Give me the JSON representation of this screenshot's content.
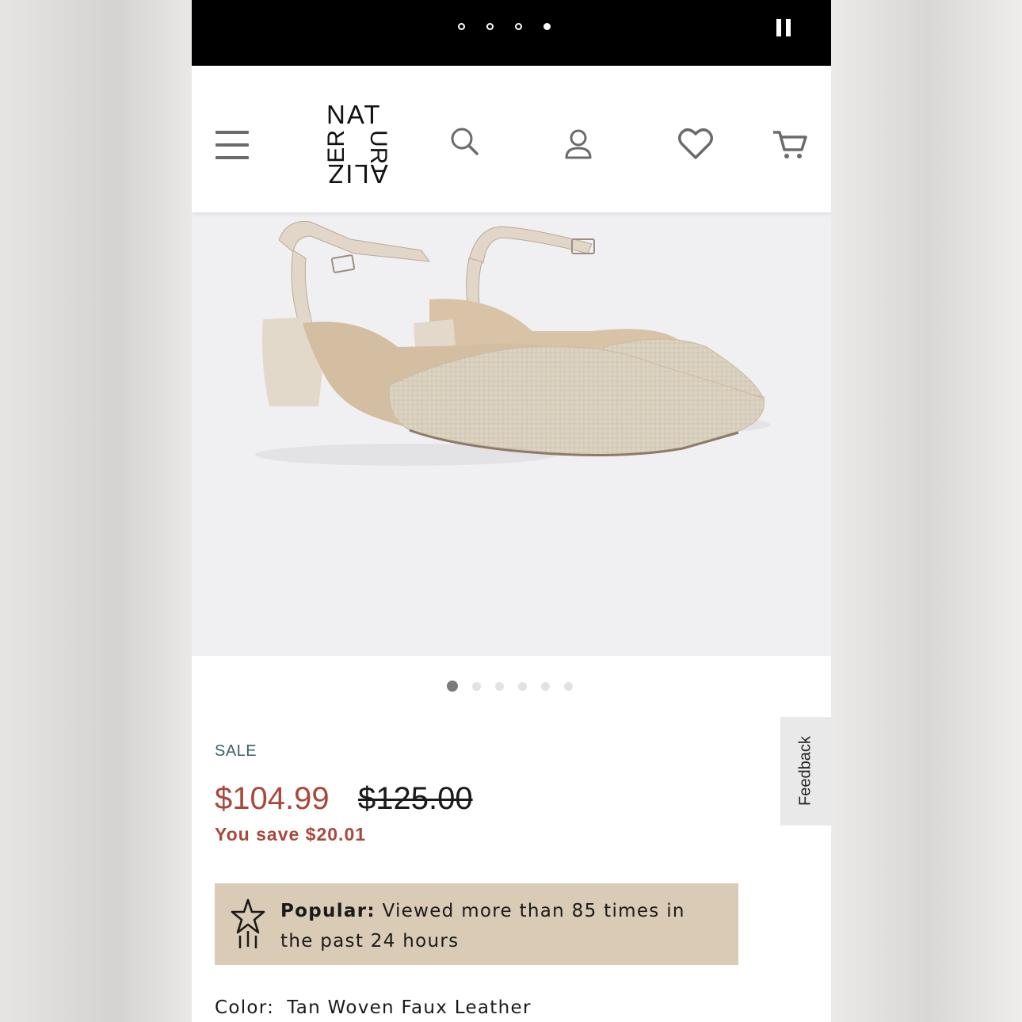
{
  "story": {
    "dots": [
      false,
      false,
      false,
      true
    ],
    "pause_icon": "pause-icon"
  },
  "header": {
    "logo": {
      "row1": "NAT",
      "left_vertical": "ER",
      "right_vertical": "UR",
      "row3": "ALIZ",
      "brand": "NATURALIZER"
    },
    "icons": [
      "menu-icon",
      "search-icon",
      "account-icon",
      "heart-icon",
      "cart-icon"
    ]
  },
  "gallery": {
    "total_images": 6,
    "active_index": 0,
    "background": "#f0eff1"
  },
  "product": {
    "sale_label": "SALE",
    "price": "$104.99",
    "original_price": "$125.00",
    "savings": "You save $20.01",
    "popular_label": "Popular:",
    "popular_text": " Viewed more than 85 times in the past 24 hours",
    "color_label": "Color:",
    "color_value": "Tan Woven Faux Leather"
  },
  "feedback": {
    "label": "Feedback"
  },
  "colors": {
    "sale_teal": "#3b5f63",
    "price_red": "#a8483a",
    "popular_bg": "#d9cbb5"
  }
}
